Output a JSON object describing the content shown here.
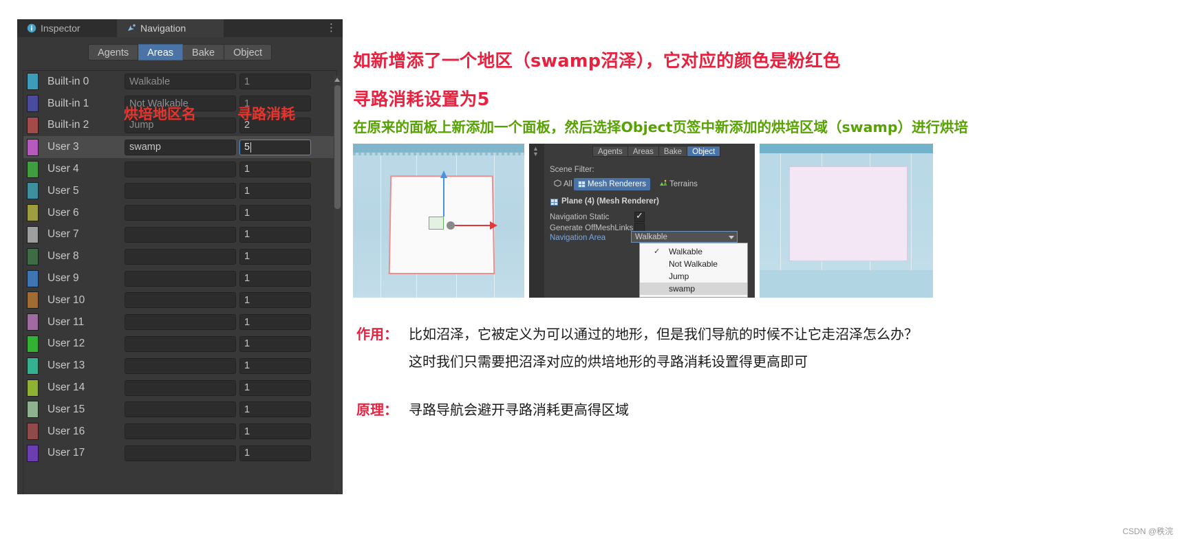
{
  "unity_window": {
    "tabs": [
      {
        "label": "Inspector",
        "icon": "info-icon",
        "active": false
      },
      {
        "label": "Navigation",
        "icon": "navigation-icon",
        "active": true
      }
    ],
    "menu_icon": "kebab-menu-icon",
    "subtabs": [
      {
        "label": "Agents",
        "selected": false
      },
      {
        "label": "Areas",
        "selected": true
      },
      {
        "label": "Bake",
        "selected": false
      },
      {
        "label": "Object",
        "selected": false
      }
    ],
    "annotations": [
      {
        "text": "烘培地区名",
        "color": "#e8342c"
      },
      {
        "text": "寻路消耗",
        "color": "#e8342c"
      }
    ],
    "areas": [
      {
        "id": "Built-in 0",
        "name": "Walkable",
        "cost": "1",
        "color": "#3c9cba",
        "name_muted": true,
        "selected": false,
        "editing": false
      },
      {
        "id": "Built-in 1",
        "name": "Not Walkable",
        "cost": "1",
        "color": "#4a4a9e",
        "name_muted": true,
        "selected": false,
        "editing": false
      },
      {
        "id": "Built-in 2",
        "name": "Jump",
        "cost": "2",
        "color": "#a34a4a",
        "name_muted": true,
        "selected": false,
        "editing": false
      },
      {
        "id": "User 3",
        "name": "swamp",
        "cost": "5",
        "color": "#b45bbd",
        "name_muted": false,
        "selected": true,
        "editing": true
      },
      {
        "id": "User 4",
        "name": "",
        "cost": "1",
        "color": "#3f9e3f",
        "name_muted": false,
        "selected": false,
        "editing": false
      },
      {
        "id": "User 5",
        "name": "",
        "cost": "1",
        "color": "#3f8f9e",
        "name_muted": false,
        "selected": false,
        "editing": false
      },
      {
        "id": "User 6",
        "name": "",
        "cost": "1",
        "color": "#9e9e3f",
        "name_muted": false,
        "selected": false,
        "editing": false
      },
      {
        "id": "User 7",
        "name": "",
        "cost": "1",
        "color": "#9e9e9e",
        "name_muted": false,
        "selected": false,
        "editing": false
      },
      {
        "id": "User 8",
        "name": "",
        "cost": "1",
        "color": "#3f6b46",
        "name_muted": false,
        "selected": false,
        "editing": false
      },
      {
        "id": "User 9",
        "name": "",
        "cost": "1",
        "color": "#3f75b0",
        "name_muted": false,
        "selected": false,
        "editing": false
      },
      {
        "id": "User 10",
        "name": "",
        "cost": "1",
        "color": "#a06c33",
        "name_muted": false,
        "selected": false,
        "editing": false
      },
      {
        "id": "User 11",
        "name": "",
        "cost": "1",
        "color": "#a06ca0",
        "name_muted": false,
        "selected": false,
        "editing": false
      },
      {
        "id": "User 12",
        "name": "",
        "cost": "1",
        "color": "#34b134",
        "name_muted": false,
        "selected": false,
        "editing": false
      },
      {
        "id": "User 13",
        "name": "",
        "cost": "1",
        "color": "#34b18f",
        "name_muted": false,
        "selected": false,
        "editing": false
      },
      {
        "id": "User 14",
        "name": "",
        "cost": "1",
        "color": "#8fb134",
        "name_muted": false,
        "selected": false,
        "editing": false
      },
      {
        "id": "User 15",
        "name": "",
        "cost": "1",
        "color": "#8fb18f",
        "name_muted": false,
        "selected": false,
        "editing": false
      },
      {
        "id": "User 16",
        "name": "",
        "cost": "1",
        "color": "#8f4a4a",
        "name_muted": false,
        "selected": false,
        "editing": false
      },
      {
        "id": "User 17",
        "name": "",
        "cost": "1",
        "color": "#6b3fb1",
        "name_muted": false,
        "selected": false,
        "editing": false
      }
    ]
  },
  "content": {
    "heading_red_line1": "如新增添了一个地区（swamp沼泽），它对应的颜色是粉红色",
    "heading_red_line2": "寻路消耗设置为5",
    "heading_green": "在原来的面板上新添加一个面板，然后选择Object页签中新添加的烘培区域（swamp）进行烘培",
    "note_purpose_label": "作用：",
    "note_purpose_line1": "比如沼泽，它被定义为可以通过的地形，但是我们导航的时候不让它走沼泽怎么办？",
    "note_purpose_line2": "这时我们只需要把沼泽对应的烘培地形的寻路消耗设置得更高即可",
    "note_principle_label": "原理：",
    "note_principle_text": "寻路导航会避开寻路消耗更高得区域",
    "colors": {
      "red": "#e8213f",
      "green": "#56a300",
      "accent_blue": "#4a74a8"
    }
  },
  "inspector_figure": {
    "tabs": [
      {
        "label": "Agents",
        "selected": false
      },
      {
        "label": "Areas",
        "selected": false
      },
      {
        "label": "Bake",
        "selected": false
      },
      {
        "label": "Object",
        "selected": true
      }
    ],
    "scene_filter_label": "Scene Filter:",
    "filters": [
      {
        "label": "All",
        "icon": "cube-icon",
        "active": false
      },
      {
        "label": "Mesh Renderers",
        "icon": "mesh-icon",
        "active": true
      },
      {
        "label": "Terrains",
        "icon": "terrain-icon",
        "active": false
      }
    ],
    "object_title": "Plane (4) (Mesh Renderer)",
    "rows": [
      {
        "label": "Navigation Static",
        "checked": true
      },
      {
        "label": "Generate OffMeshLinks",
        "checked": false
      }
    ],
    "nav_area_label": "Navigation Area",
    "nav_area_value": "Walkable",
    "dropdown_options": [
      {
        "label": "Walkable",
        "checked": true,
        "highlighted": false
      },
      {
        "label": "Not Walkable",
        "checked": false,
        "highlighted": false
      },
      {
        "label": "Jump",
        "checked": false,
        "highlighted": false
      },
      {
        "label": "swamp",
        "checked": false,
        "highlighted": true
      }
    ]
  },
  "watermark": "CSDN @秩浣"
}
